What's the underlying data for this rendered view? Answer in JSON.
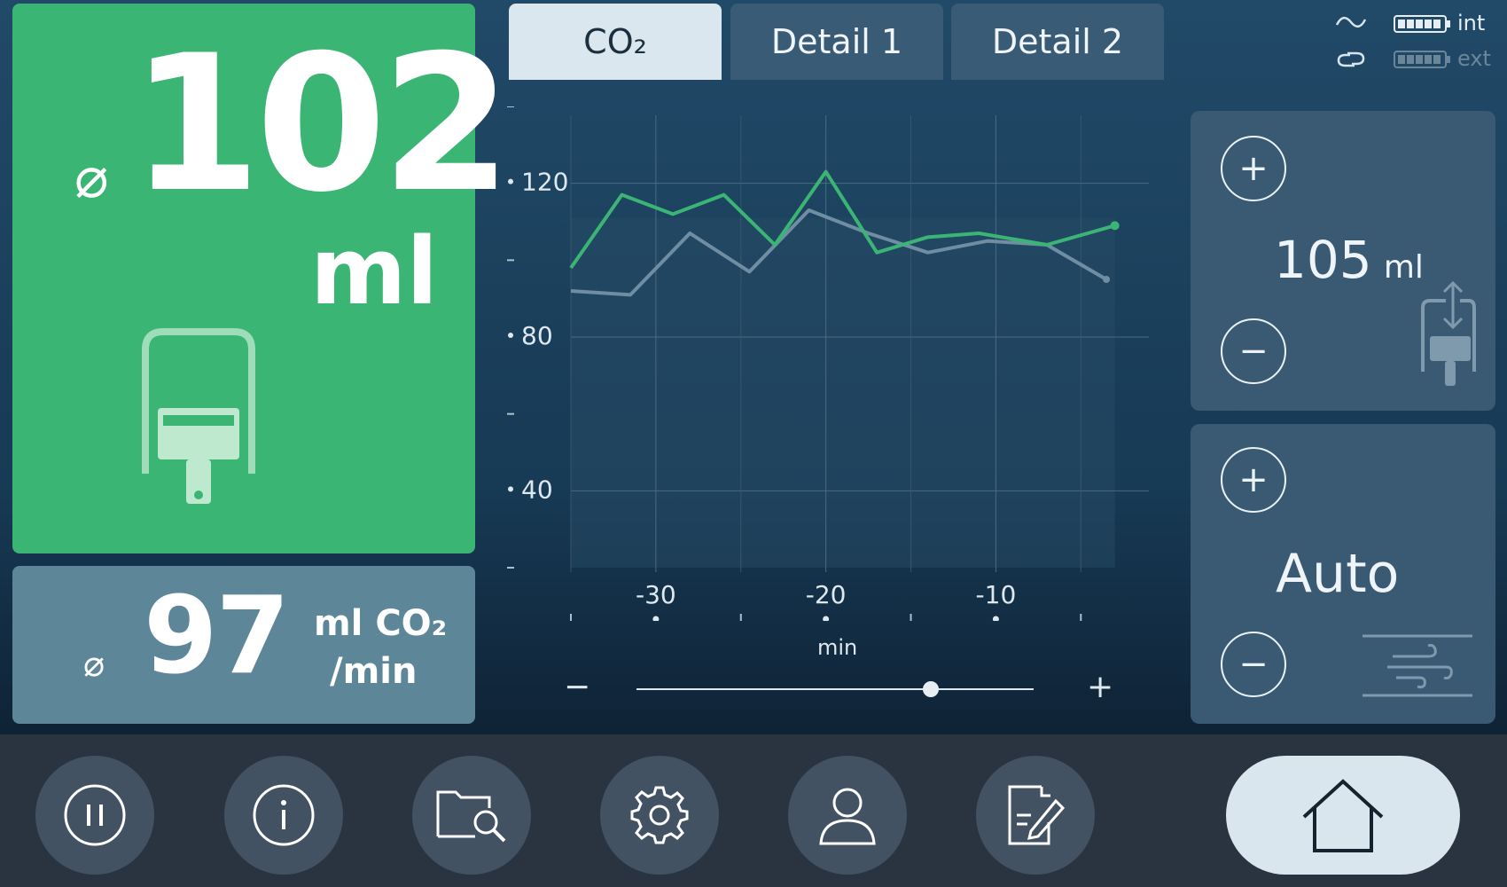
{
  "main_panel": {
    "avg_symbol": "⌀",
    "value": "102",
    "unit": "ml",
    "icon": "ventilator-canister-icon"
  },
  "co2_panel": {
    "avg_symbol": "⌀",
    "value": "97",
    "unit_line1": "ml CO₂",
    "unit_line2": "/min"
  },
  "tabs": [
    {
      "label": "CO₂",
      "active": true
    },
    {
      "label": "Detail 1",
      "active": false
    },
    {
      "label": "Detail 2",
      "active": false
    }
  ],
  "status": {
    "power_int_label": "int",
    "power_ext_label": "ext",
    "ac_icon": "ac-power-icon",
    "link_icon": "link-icon"
  },
  "chart_data": {
    "type": "line",
    "xlabel": "min",
    "ylabel": "",
    "x_ticks": [
      "-30",
      "-20",
      "-10"
    ],
    "y_ticks": [
      "40",
      "80",
      "120"
    ],
    "xlim": [
      -35,
      -1
    ],
    "ylim": [
      20,
      140
    ],
    "grid": true,
    "series": [
      {
        "color": "#3bb574",
        "x": [
          -35,
          -32,
          -29,
          -26,
          -23,
          -20,
          -17,
          -14,
          -11,
          -7,
          -3
        ],
        "y": [
          98,
          117,
          112,
          117,
          104,
          123,
          102,
          106,
          107,
          104,
          109
        ]
      },
      {
        "color": "#6f8ea3",
        "x": [
          -35,
          -31.5,
          -28,
          -24.5,
          -21,
          -17.5,
          -14,
          -10.5,
          -7,
          -3.5
        ],
        "y": [
          92,
          91,
          107,
          97,
          113,
          107,
          102,
          105,
          104,
          95
        ]
      }
    ]
  },
  "zoom": {
    "minus_label": "−",
    "plus_label": "+",
    "level": 0.74
  },
  "volume_setting": {
    "plus_label": "+",
    "minus_label": "−",
    "value": "105",
    "unit": "ml",
    "icon": "canister-transfer-icon"
  },
  "mode_setting": {
    "plus_label": "+",
    "minus_label": "−",
    "value": "Auto",
    "icon": "airflow-icon"
  },
  "nav": [
    {
      "name": "pause-button",
      "icon": "pause-icon"
    },
    {
      "name": "info-button",
      "icon": "info-icon"
    },
    {
      "name": "folder-search-button",
      "icon": "folder-search-icon"
    },
    {
      "name": "settings-button",
      "icon": "gear-icon"
    },
    {
      "name": "user-button",
      "icon": "user-icon"
    },
    {
      "name": "notes-button",
      "icon": "document-edit-icon"
    },
    {
      "name": "home-button",
      "icon": "home-icon"
    }
  ],
  "colors": {
    "accent_green": "#3bb574",
    "panel_blue": "#5e8699",
    "bottom_bar": "#2a3440"
  }
}
